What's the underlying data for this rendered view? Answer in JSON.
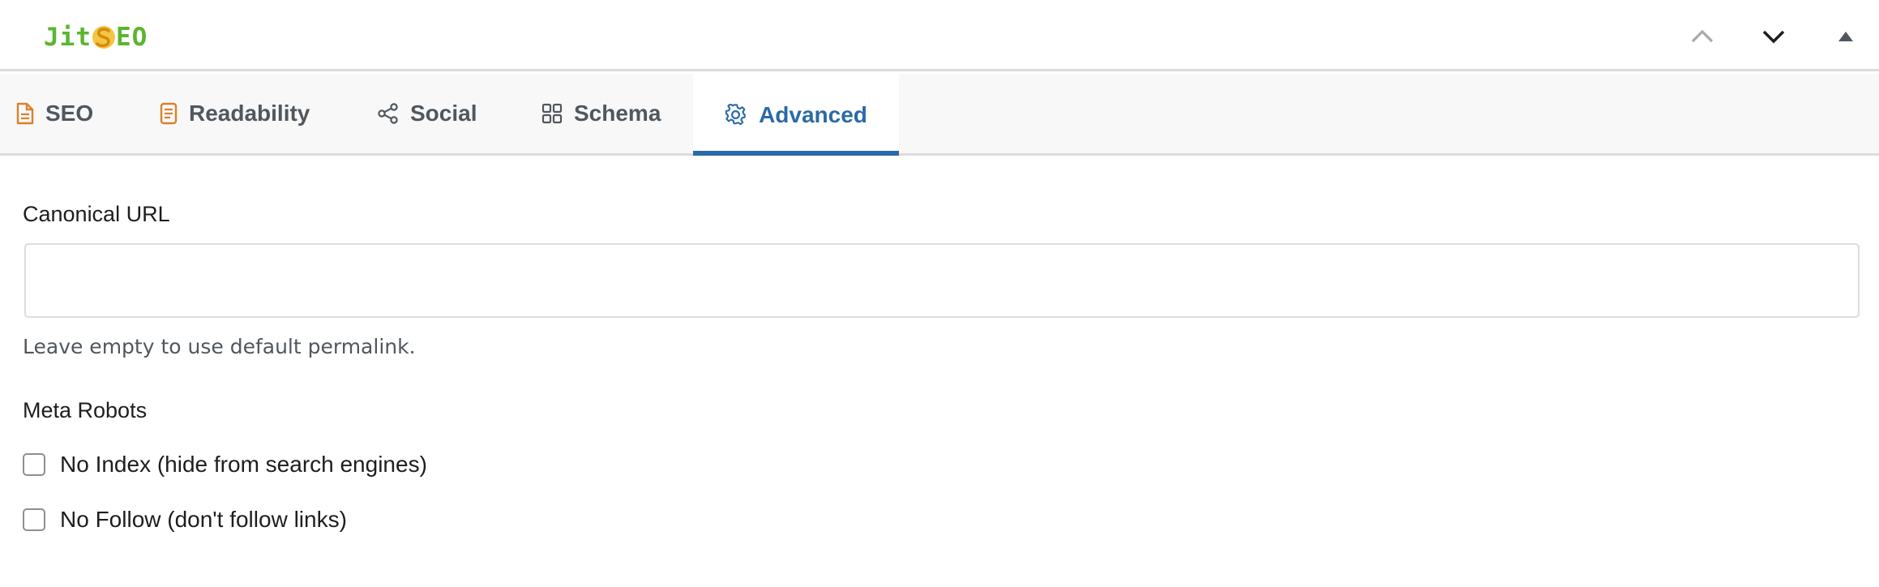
{
  "header": {
    "logo": {
      "prefix": "Jit",
      "suffix": "EO"
    },
    "move_up_icon": "chevron-up-icon",
    "move_down_icon": "chevron-down-icon",
    "toggle_icon": "triangle-up-icon"
  },
  "tabs": [
    {
      "label": "SEO",
      "icon": "document-icon",
      "active": false
    },
    {
      "label": "Readability",
      "icon": "text-document-icon",
      "active": false
    },
    {
      "label": "Social",
      "icon": "share-icon",
      "active": false
    },
    {
      "label": "Schema",
      "icon": "grid-icon",
      "active": false
    },
    {
      "label": "Advanced",
      "icon": "gear-icon",
      "active": true
    }
  ],
  "advanced": {
    "canonical_label": "Canonical URL",
    "canonical_value": "",
    "canonical_help": "Leave empty to use default permalink.",
    "robots_label": "Meta Robots",
    "noindex_label": "No Index (hide from search engines)",
    "noindex_checked": false,
    "nofollow_label": "No Follow (don't follow links)",
    "nofollow_checked": false
  },
  "colors": {
    "brand_green": "#5ab530",
    "brand_yellow": "#f0b429",
    "tab_icon_orange": "#d9822b",
    "active_tab_blue": "#2a6aa6"
  }
}
